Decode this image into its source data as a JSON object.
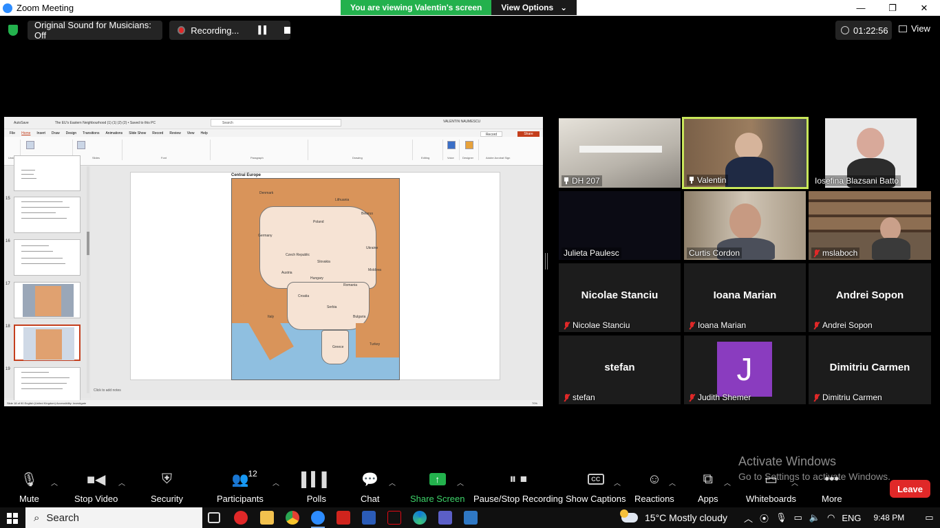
{
  "window": {
    "title": "Zoom Meeting"
  },
  "banner": {
    "viewing": "You are viewing Valentin's screen",
    "view_options": "View Options"
  },
  "status": {
    "sound": "Original Sound for Musicians: Off",
    "recording": "Recording...",
    "timer": "01:22:56",
    "view": "View"
  },
  "ppt": {
    "autosave": "AutoSave",
    "file_title": "The EU's Eastern Neighbourhood (1) (1) (2) (2) • Saved to this PC",
    "search": "Search",
    "user": "VALENTIN NAUMESCU",
    "tabs": [
      "File",
      "Home",
      "Insert",
      "Draw",
      "Design",
      "Transitions",
      "Animations",
      "Slide Show",
      "Record",
      "Review",
      "View",
      "Help"
    ],
    "record_btn": "Record",
    "share_btn": "Share",
    "groups": [
      "Undo",
      "Clipboard",
      "Slides",
      "Font",
      "Paragraph",
      "Drawing",
      "Editing",
      "Voice",
      "Designer",
      "Adobe Acrobat Sign"
    ],
    "slide_numbers": [
      "15",
      "16",
      "17",
      "18",
      "19"
    ],
    "slide_title": "Central Europe",
    "map_labels": [
      "Denmark",
      "Germany",
      "Poland",
      "Lithuania",
      "Belarus",
      "Ukraine",
      "Czech Republic",
      "Slovakia",
      "Austria",
      "Hungary",
      "Romania",
      "Moldova",
      "Italy",
      "Serbia",
      "Bulgaria",
      "Greece",
      "Turkey",
      "Croatia"
    ],
    "notes": "Click to add notes",
    "statusbar": "Slide 18 of 90    English (United Kingdom)    Accessibility: Investigate",
    "zoom": "70%"
  },
  "participants": [
    {
      "name": "DH 207",
      "pinned": true,
      "muted": false,
      "big": ""
    },
    {
      "name": "Valentin",
      "pinned": true,
      "muted": false,
      "big": ""
    },
    {
      "name": "Iosefina Blazsani Batto",
      "pinned": false,
      "muted": false,
      "big": ""
    },
    {
      "name": "Julieta Paulesc",
      "pinned": false,
      "muted": false,
      "big": ""
    },
    {
      "name": "Curtis Cordon",
      "pinned": false,
      "muted": false,
      "big": ""
    },
    {
      "name": "mslaboch",
      "pinned": false,
      "muted": true,
      "big": ""
    },
    {
      "name": "Nicolae Stanciu",
      "pinned": false,
      "muted": true,
      "big": "Nicolae Stanciu"
    },
    {
      "name": "Ioana Marian",
      "pinned": false,
      "muted": true,
      "big": "Ioana Marian"
    },
    {
      "name": "Andrei Sopon",
      "pinned": false,
      "muted": true,
      "big": "Andrei Sopon"
    },
    {
      "name": "stefan",
      "pinned": false,
      "muted": true,
      "big": "stefan"
    },
    {
      "name": "Judith Shemer",
      "pinned": false,
      "muted": true,
      "big": "",
      "avatar": "J"
    },
    {
      "name": "Dimitriu Carmen",
      "pinned": false,
      "muted": true,
      "big": "Dimitriu Carmen"
    }
  ],
  "watermark": {
    "title": "Activate Windows",
    "subtitle": "Go to Settings to activate Windows."
  },
  "toolbar": {
    "mute": "Mute",
    "stop_video": "Stop Video",
    "security": "Security",
    "participants": "Participants",
    "participants_count": "12",
    "polls": "Polls",
    "chat": "Chat",
    "share_screen": "Share Screen",
    "pause_recording": "Pause/Stop Recording",
    "captions": "Show Captions",
    "captions_icon": "CC",
    "reactions": "Reactions",
    "apps": "Apps",
    "whiteboards": "Whiteboards",
    "more": "More",
    "leave": "Leave"
  },
  "taskbar": {
    "search": "Search",
    "weather": "15°C  Mostly cloudy",
    "lang": "ENG",
    "time": "9:48 PM"
  },
  "colors": {
    "accent_green": "#23b14d",
    "leave_red": "#e02828",
    "active_speaker": "#c9e85a",
    "avatar_purple": "#8a3cbf"
  }
}
